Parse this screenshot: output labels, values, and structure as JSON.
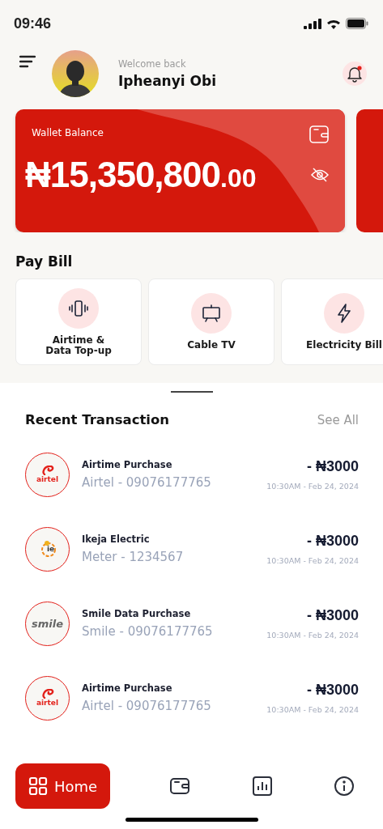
{
  "status_bar": {
    "time": "09:46"
  },
  "header": {
    "greeting": "Welcome back",
    "name": "Ipheanyi Obi",
    "has_notification": true
  },
  "wallet": {
    "label": "Wallet Balance",
    "amount": "₦15,350,800",
    "decimals": ".00"
  },
  "pay_bill": {
    "title": "Pay Bill",
    "items": [
      {
        "kind": "phone",
        "label": "Airtime &\nData Top-up"
      },
      {
        "kind": "tv",
        "label": "Cable TV"
      },
      {
        "kind": "bolt",
        "label": "Electricity Bill"
      }
    ]
  },
  "recent": {
    "title": "Recent Transaction",
    "see_all": "See All",
    "items": [
      {
        "kind": "airtel",
        "logo_text": "airtel",
        "title": "Airtime Purchase",
        "detail": "Airtel - 09076177765",
        "amount": "- ₦3000",
        "time": "10:30AM - Feb 24, 2024"
      },
      {
        "kind": "ikeja",
        "logo_text": "ie",
        "title": "Ikeja Electric",
        "detail": "Meter - 1234567",
        "amount": "- ₦3000",
        "time": "10:30AM - Feb 24, 2024"
      },
      {
        "kind": "smile",
        "logo_text": "smile",
        "title": "Smile Data Purchase",
        "detail": "Smile - 09076177765",
        "amount": "- ₦3000",
        "time": "10:30AM - Feb 24, 2024"
      },
      {
        "kind": "airtel",
        "logo_text": "airtel",
        "title": "Airtime Purchase",
        "detail": "Airtel - 09076177765",
        "amount": "- ₦3000",
        "time": "10:30AM - Feb 24, 2024"
      }
    ]
  },
  "nav": [
    {
      "kind": "grid",
      "label": "Home",
      "selected": true
    },
    {
      "kind": "wallet",
      "selected": false
    },
    {
      "kind": "chart",
      "selected": false
    },
    {
      "kind": "info",
      "selected": false
    }
  ]
}
